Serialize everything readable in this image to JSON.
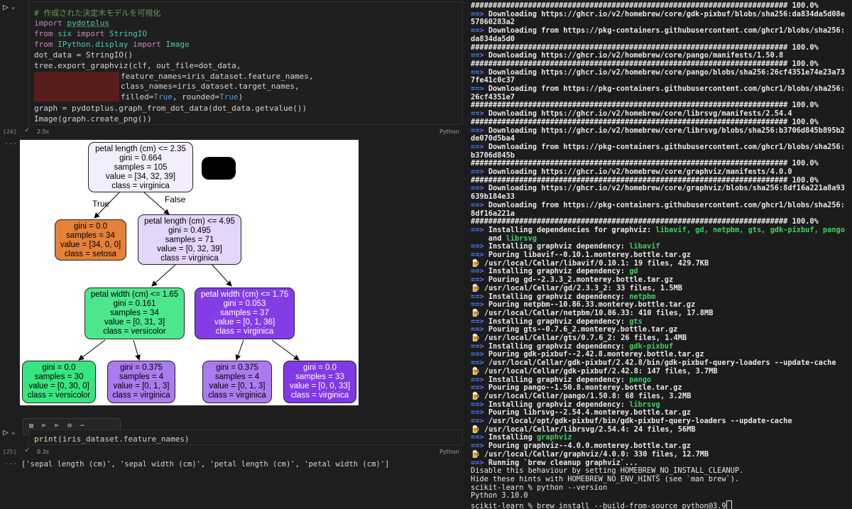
{
  "notebook": {
    "cell1": {
      "exec_count": "[24]",
      "time": "2.5s",
      "language": "Python",
      "lines": {
        "comment": "# 作成された決定木モデルを可視化",
        "l2_kw": "import",
        "l2_mod": "pydotplus",
        "l3_kw1": "from",
        "l3_mod": "six",
        "l3_kw2": "import",
        "l3_name": "StringIO",
        "l4_kw1": "from",
        "l4_mod": "IPython.display",
        "l4_kw2": "import",
        "l4_name": "Image",
        "l5": "dot_data = StringIO()",
        "l6": "tree.export_graphviz(clf, out_file=dot_data,",
        "l7": "feature_names=iris_dataset.feature_names,",
        "l8": "class_names=iris_dataset.target_names,",
        "l9_a": "filled=",
        "l9_b": "True",
        "l9_c": ", rounded=",
        "l9_d": "True",
        "l9_e": ")",
        "l10": "graph = pydotplus.graph_from_dot_data(dot_data.getvalue())",
        "l11": "Image(graph.create_png())"
      }
    },
    "output_ellipsis": "...",
    "tree": {
      "edge_true": "True",
      "edge_false": "False",
      "nodes": [
        {
          "line1": "petal length (cm) <= 2.35",
          "line2": "gini = 0.664",
          "line3": "samples = 105",
          "line4": "value = [34, 32, 39]",
          "line5": "class = virginica",
          "color": "#f3eefd"
        },
        {
          "line1": "gini = 0.0",
          "line2": "samples = 34",
          "line3": "value = [34, 0, 0]",
          "line4": "class = setosa",
          "color": "#e58139"
        },
        {
          "line1": "petal length (cm) <= 4.95",
          "line2": "gini = 0.495",
          "line3": "samples = 71",
          "line4": "value = [0, 32, 39]",
          "line5": "class = virginica",
          "color": "#e3d6fa"
        },
        {
          "line1": "petal width (cm) <= 1.65",
          "line2": "gini = 0.161",
          "line3": "samples = 34",
          "line4": "value = [0, 31, 3]",
          "line5": "class = versicolor",
          "color": "#4ce78d"
        },
        {
          "line1": "petal width (cm) <= 1.75",
          "line2": "gini = 0.053",
          "line3": "samples = 37",
          "line4": "value = [0, 1, 36]",
          "line5": "class = virginica",
          "color": "#843de6"
        },
        {
          "line1": "gini = 0.0",
          "line2": "samples = 30",
          "line3": "value = [0, 30, 0]",
          "line4": "class = versicolor",
          "color": "#39e581"
        },
        {
          "line1": "gini = 0.375",
          "line2": "samples = 4",
          "line3": "value = [0, 1, 3]",
          "line4": "class = virginica",
          "color": "#ab7bee"
        },
        {
          "line1": "gini = 0.375",
          "line2": "samples = 4",
          "line3": "value = [0, 1, 3]",
          "line4": "class = virginica",
          "color": "#ab7bee"
        },
        {
          "line1": "gini = 0.0",
          "line2": "samples = 33",
          "line3": "value = [0, 0, 33]",
          "line4": "class = virginica",
          "color": "#8139e5"
        }
      ]
    },
    "toolbar": {
      "icons": [
        "cell-format-icon",
        "run-above-icon",
        "run-below-icon",
        "split-cell-icon",
        "more-icon"
      ]
    },
    "cell2": {
      "exec_count": "[25]",
      "time": "0.3s",
      "language": "Python",
      "code_a": "print",
      "code_b": "(iris_dataset.feature_names)",
      "output": "['sepal length (cm)', 'sepal width (cm)', 'petal length (cm)', 'petal width (cm)']"
    }
  },
  "terminal": {
    "lines": [
      {
        "t": "hash",
        "text": "######################################################################## 100.0%"
      },
      {
        "t": "arrow",
        "text": "Downloading https://ghcr.io/v2/homebrew/core/gdk-pixbuf/blobs/sha256:da834da5d08e"
      },
      {
        "t": "bold",
        "text": "57860283a2"
      },
      {
        "t": "arrow",
        "text": "Downloading from https://pkg-containers.githubusercontent.com/ghcr1/blobs/sha256:"
      },
      {
        "t": "bold",
        "text": "da834da5d0"
      },
      {
        "t": "hash",
        "text": "######################################################################## 100.0%"
      },
      {
        "t": "arrow",
        "text": "Downloading https://ghcr.io/v2/homebrew/core/pango/manifests/1.50.8"
      },
      {
        "t": "hash",
        "text": "######################################################################## 100.0%"
      },
      {
        "t": "arrow",
        "text": "Downloading https://ghcr.io/v2/homebrew/core/pango/blobs/sha256:26cf4351e74e23a73"
      },
      {
        "t": "bold",
        "text": "7fe41c0c37"
      },
      {
        "t": "arrow",
        "text": "Downloading from https://pkg-containers.githubusercontent.com/ghcr1/blobs/sha256:"
      },
      {
        "t": "bold",
        "text": "26cf4351e7"
      },
      {
        "t": "hash",
        "text": "######################################################################## 100.0%"
      },
      {
        "t": "arrow",
        "text": "Downloading https://ghcr.io/v2/homebrew/core/librsvg/manifests/2.54.4"
      },
      {
        "t": "hash",
        "text": "######################################################################## 100.0%"
      },
      {
        "t": "arrow",
        "text": "Downloading https://ghcr.io/v2/homebrew/core/librsvg/blobs/sha256:b3706d845b895b2"
      },
      {
        "t": "bold",
        "text": "de070d5ba4"
      },
      {
        "t": "arrow",
        "text": "Downloading from https://pkg-containers.githubusercontent.com/ghcr1/blobs/sha256:"
      },
      {
        "t": "bold",
        "text": "b3706d845b"
      },
      {
        "t": "hash",
        "text": "######################################################################## 100.0%"
      },
      {
        "t": "arrow",
        "text": "Downloading https://ghcr.io/v2/homebrew/core/graphviz/manifests/4.0.0"
      },
      {
        "t": "hash",
        "text": "######################################################################## 100.0%"
      },
      {
        "t": "arrow",
        "text": "Downloading https://ghcr.io/v2/homebrew/core/graphviz/blobs/sha256:8df16a221a8a93"
      },
      {
        "t": "bold",
        "text": "639b184e33"
      },
      {
        "t": "arrow",
        "text": "Downloading from https://pkg-containers.githubusercontent.com/ghcr1/blobs/sha256:"
      },
      {
        "t": "bold",
        "text": "8df16a221a"
      },
      {
        "t": "hash",
        "text": "######################################################################## 100.0%"
      },
      {
        "t": "arrowg",
        "text": "Installing dependencies for graphviz: ",
        "g": "libavif, gd, netpbm, gts, gdk-pixbuf, pango"
      },
      {
        "t": "contg",
        "text": "and ",
        "g": "librsvg"
      },
      {
        "t": "arrowg",
        "text": "Installing graphviz dependency: ",
        "g": "libavif"
      },
      {
        "t": "arrow",
        "text": "Pouring libavif--0.10.1.monterey.bottle.tar.gz"
      },
      {
        "t": "beer",
        "text": "/usr/local/Cellar/libavif/0.10.1: 19 files, 429.7KB"
      },
      {
        "t": "arrowg",
        "text": "Installing graphviz dependency: ",
        "g": "gd"
      },
      {
        "t": "arrow",
        "text": "Pouring gd--2.3.3_2.monterey.bottle.tar.gz"
      },
      {
        "t": "beer",
        "text": "/usr/local/Cellar/gd/2.3.3_2: 33 files, 1.5MB"
      },
      {
        "t": "arrowg",
        "text": "Installing graphviz dependency: ",
        "g": "netpbm"
      },
      {
        "t": "arrow",
        "text": "Pouring netpbm--10.86.33.monterey.bottle.tar.gz"
      },
      {
        "t": "beer",
        "text": "/usr/local/Cellar/netpbm/10.86.33: 410 files, 17.8MB"
      },
      {
        "t": "arrowg",
        "text": "Installing graphviz dependency: ",
        "g": "gts"
      },
      {
        "t": "arrow",
        "text": "Pouring gts--0.7.6_2.monterey.bottle.tar.gz"
      },
      {
        "t": "beer",
        "text": "/usr/local/Cellar/gts/0.7.6_2: 26 files, 1.4MB"
      },
      {
        "t": "arrowg",
        "text": "Installing graphviz dependency: ",
        "g": "gdk-pixbuf"
      },
      {
        "t": "arrow",
        "text": "Pouring gdk-pixbuf--2.42.8.monterey.bottle.tar.gz"
      },
      {
        "t": "arrow",
        "text": "/usr/local/Cellar/gdk-pixbuf/2.42.8/bin/gdk-pixbuf-query-loaders --update-cache"
      },
      {
        "t": "beer",
        "text": "/usr/local/Cellar/gdk-pixbuf/2.42.8: 147 files, 3.7MB"
      },
      {
        "t": "arrowg",
        "text": "Installing graphviz dependency: ",
        "g": "pango"
      },
      {
        "t": "arrow",
        "text": "Pouring pango--1.50.8.monterey.bottle.tar.gz"
      },
      {
        "t": "beer",
        "text": "/usr/local/Cellar/pango/1.50.8: 68 files, 3.2MB"
      },
      {
        "t": "arrowg",
        "text": "Installing graphviz dependency: ",
        "g": "librsvg"
      },
      {
        "t": "arrow",
        "text": "Pouring librsvg--2.54.4.monterey.bottle.tar.gz"
      },
      {
        "t": "arrow",
        "text": "/usr/local/opt/gdk-pixbuf/bin/gdk-pixbuf-query-loaders --update-cache"
      },
      {
        "t": "beer",
        "text": "/usr/local/Cellar/librsvg/2.54.4: 24 files, 56MB"
      },
      {
        "t": "arrowg",
        "text": "Installing ",
        "g": "graphviz"
      },
      {
        "t": "arrow",
        "text": "Pouring graphviz--4.0.0.monterey.bottle.tar.gz"
      },
      {
        "t": "beer",
        "text": "/usr/local/Cellar/graphviz/4.0.0: 330 files, 12.7MB"
      },
      {
        "t": "arrow",
        "text": "Running `brew cleanup graphviz`..."
      },
      {
        "t": "plain",
        "text": "Disable this behaviour by setting HOMEBREW_NO_INSTALL_CLEANUP."
      },
      {
        "t": "plain",
        "text": "Hide these hints with HOMEBREW_NO_ENV_HINTS (see `man brew`)."
      },
      {
        "t": "plain",
        "text": "scikit-learn % python --version"
      },
      {
        "t": "plain",
        "text": "Python 3.10.0"
      },
      {
        "t": "cursor",
        "text": "scikit-learn % brew install --build-from-source python@3.9"
      }
    ],
    "arrow_glyph": "==>",
    "beer_glyph": "🍺"
  }
}
